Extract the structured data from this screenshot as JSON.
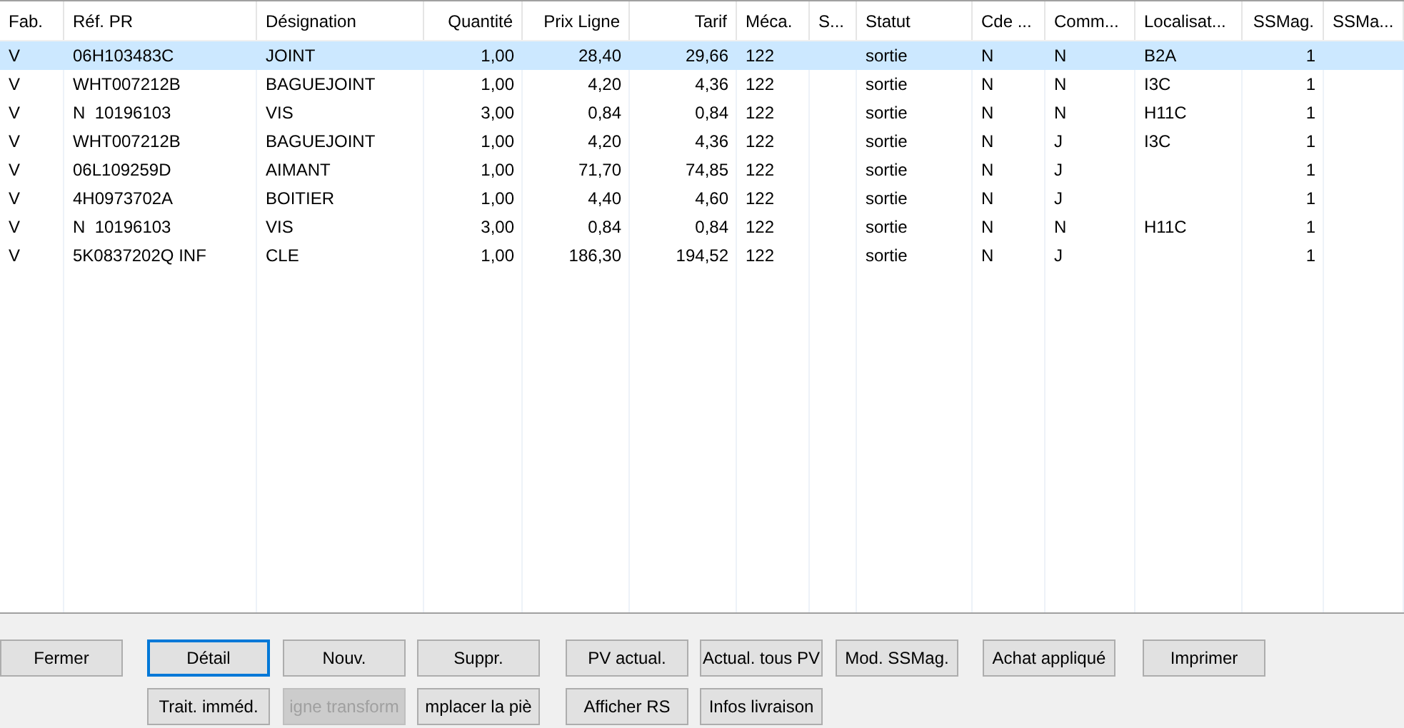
{
  "table": {
    "columns": [
      {
        "label": "Fab.",
        "kind": "text"
      },
      {
        "label": "Réf. PR",
        "kind": "text"
      },
      {
        "label": "Désignation",
        "kind": "text"
      },
      {
        "label": "Quantité",
        "kind": "number"
      },
      {
        "label": "Prix Ligne",
        "kind": "number"
      },
      {
        "label": "Tarif",
        "kind": "number"
      },
      {
        "label": "Méca.",
        "kind": "text"
      },
      {
        "label": "S...",
        "kind": "text"
      },
      {
        "label": "Statut",
        "kind": "text"
      },
      {
        "label": "Cde ...",
        "kind": "text"
      },
      {
        "label": "Comm...",
        "kind": "text"
      },
      {
        "label": "Localisat...",
        "kind": "text"
      },
      {
        "label": "SSMag.",
        "kind": "number"
      },
      {
        "label": "SSMa...",
        "kind": "text"
      }
    ],
    "rows": [
      {
        "selected": true,
        "cells": [
          "V",
          "06H103483C",
          "JOINT",
          "1,00",
          "28,40",
          "29,66",
          "122",
          "",
          "sortie",
          "N",
          "N",
          "B2A",
          "1",
          ""
        ]
      },
      {
        "selected": false,
        "cells": [
          "V",
          "WHT007212B",
          "BAGUEJOINT",
          "1,00",
          "4,20",
          "4,36",
          "122",
          "",
          "sortie",
          "N",
          "N",
          "I3C",
          "1",
          ""
        ]
      },
      {
        "selected": false,
        "cells": [
          "V",
          "N  10196103",
          "VIS",
          "3,00",
          "0,84",
          "0,84",
          "122",
          "",
          "sortie",
          "N",
          "N",
          "H11C",
          "1",
          ""
        ]
      },
      {
        "selected": false,
        "cells": [
          "V",
          "WHT007212B",
          "BAGUEJOINT",
          "1,00",
          "4,20",
          "4,36",
          "122",
          "",
          "sortie",
          "N",
          "J",
          "I3C",
          "1",
          ""
        ]
      },
      {
        "selected": false,
        "cells": [
          "V",
          "06L109259D",
          "AIMANT",
          "1,00",
          "71,70",
          "74,85",
          "122",
          "",
          "sortie",
          "N",
          "J",
          "",
          "1",
          ""
        ]
      },
      {
        "selected": false,
        "cells": [
          "V",
          "4H0973702A",
          "BOITIER",
          "1,00",
          "4,40",
          "4,60",
          "122",
          "",
          "sortie",
          "N",
          "J",
          "",
          "1",
          ""
        ]
      },
      {
        "selected": false,
        "cells": [
          "V",
          "N  10196103",
          "VIS",
          "3,00",
          "0,84",
          "0,84",
          "122",
          "",
          "sortie",
          "N",
          "N",
          "H11C",
          "1",
          ""
        ]
      },
      {
        "selected": false,
        "cells": [
          "V",
          "5K0837202Q INF",
          "CLE",
          "1,00",
          "186,30",
          "194,52",
          "122",
          "",
          "sortie",
          "N",
          "J",
          "",
          "1",
          ""
        ]
      }
    ]
  },
  "buttons_row1": [
    {
      "label": "Fermer",
      "focused": false,
      "disabled": false
    },
    {
      "label": "Détail",
      "focused": true,
      "disabled": false
    },
    {
      "label": "Nouv.",
      "focused": false,
      "disabled": false
    },
    {
      "label": "Suppr.",
      "focused": false,
      "disabled": false
    },
    {
      "label": "PV actual.",
      "focused": false,
      "disabled": false
    },
    {
      "label": "Actual. tous PV",
      "focused": false,
      "disabled": false
    },
    {
      "label": "Mod. SSMag.",
      "focused": false,
      "disabled": false
    },
    {
      "label": "Achat appliqué",
      "focused": false,
      "disabled": false
    },
    {
      "label": "Imprimer",
      "focused": false,
      "disabled": false
    }
  ],
  "buttons_row2": [
    {
      "label": "Trait. imméd.",
      "focused": false,
      "disabled": false
    },
    {
      "label": "igne transform",
      "focused": false,
      "disabled": true
    },
    {
      "label": "mplacer la piè",
      "focused": false,
      "disabled": false
    },
    {
      "label": "Afficher RS",
      "focused": false,
      "disabled": false
    },
    {
      "label": "Infos livraison",
      "focused": false,
      "disabled": false
    }
  ]
}
